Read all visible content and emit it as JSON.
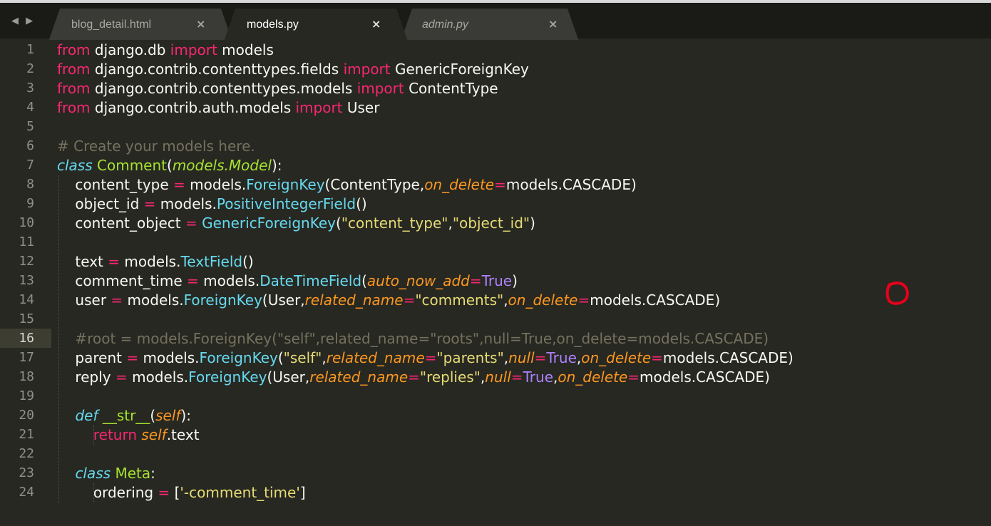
{
  "tabs": [
    {
      "label": "blog_detail.html",
      "close": "×",
      "active": false,
      "italic": false
    },
    {
      "label": "models.py",
      "close": "×",
      "active": true,
      "italic": false
    },
    {
      "label": "admin.py",
      "close": "×",
      "active": false,
      "italic": true
    }
  ],
  "nav_arrows": "◀ ▶",
  "current_line": 16,
  "colors": {
    "background": "#272822",
    "keyword": "#f92672",
    "function": "#66d9ef",
    "class_name": "#a6e22e",
    "parameter": "#fd971f",
    "string": "#e6db74",
    "constant": "#ae81ff",
    "comment": "#75715e",
    "annotation": "#e8001a"
  },
  "annotation_icon": "hand-drawn-red-circle",
  "lines": [
    {
      "n": "1",
      "tokens": [
        [
          "kw",
          "from"
        ],
        [
          "plain",
          " django.db "
        ],
        [
          "kw",
          "import"
        ],
        [
          "plain",
          " models"
        ]
      ]
    },
    {
      "n": "2",
      "tokens": [
        [
          "kw",
          "from"
        ],
        [
          "plain",
          " django.contrib.contenttypes.fields "
        ],
        [
          "kw",
          "import"
        ],
        [
          "plain",
          " GenericForeignKey"
        ]
      ]
    },
    {
      "n": "3",
      "tokens": [
        [
          "kw",
          "from"
        ],
        [
          "plain",
          " django.contrib.contenttypes.models "
        ],
        [
          "kw",
          "import"
        ],
        [
          "plain",
          " ContentType"
        ]
      ]
    },
    {
      "n": "4",
      "tokens": [
        [
          "kw",
          "from"
        ],
        [
          "plain",
          " django.contrib.auth.models "
        ],
        [
          "kw",
          "import"
        ],
        [
          "plain",
          " User"
        ]
      ]
    },
    {
      "n": "5",
      "tokens": []
    },
    {
      "n": "6",
      "tokens": [
        [
          "cmt",
          "# Create your models here."
        ]
      ]
    },
    {
      "n": "7",
      "tokens": [
        [
          "cls",
          "class"
        ],
        [
          "plain",
          " "
        ],
        [
          "ent",
          "Comment"
        ],
        [
          "plain",
          "("
        ],
        [
          "inh",
          "models.Model"
        ],
        [
          "plain",
          "):"
        ]
      ]
    },
    {
      "n": "8",
      "tokens": [
        [
          "plain",
          "    content_type "
        ],
        [
          "op",
          "="
        ],
        [
          "plain",
          " models."
        ],
        [
          "fn",
          "ForeignKey"
        ],
        [
          "plain",
          "(ContentType,"
        ],
        [
          "param",
          "on_delete"
        ],
        [
          "op",
          "="
        ],
        [
          "plain",
          "models.CASCADE)"
        ]
      ]
    },
    {
      "n": "9",
      "tokens": [
        [
          "plain",
          "    object_id "
        ],
        [
          "op",
          "="
        ],
        [
          "plain",
          " models."
        ],
        [
          "fn",
          "PositiveIntegerField"
        ],
        [
          "plain",
          "()"
        ]
      ]
    },
    {
      "n": "10",
      "tokens": [
        [
          "plain",
          "    content_object "
        ],
        [
          "op",
          "="
        ],
        [
          "plain",
          " "
        ],
        [
          "fn",
          "GenericForeignKey"
        ],
        [
          "plain",
          "("
        ],
        [
          "str",
          "\"content_type\""
        ],
        [
          "plain",
          ","
        ],
        [
          "str",
          "\"object_id\""
        ],
        [
          "plain",
          ")"
        ]
      ]
    },
    {
      "n": "11",
      "tokens": []
    },
    {
      "n": "12",
      "tokens": [
        [
          "plain",
          "    text "
        ],
        [
          "op",
          "="
        ],
        [
          "plain",
          " models."
        ],
        [
          "fn",
          "TextField"
        ],
        [
          "plain",
          "()"
        ]
      ]
    },
    {
      "n": "13",
      "tokens": [
        [
          "plain",
          "    comment_time "
        ],
        [
          "op",
          "="
        ],
        [
          "plain",
          " models."
        ],
        [
          "fn",
          "DateTimeField"
        ],
        [
          "plain",
          "("
        ],
        [
          "param",
          "auto_now_add"
        ],
        [
          "op",
          "="
        ],
        [
          "const",
          "True"
        ],
        [
          "plain",
          ")"
        ]
      ]
    },
    {
      "n": "14",
      "tokens": [
        [
          "plain",
          "    user "
        ],
        [
          "op",
          "="
        ],
        [
          "plain",
          " models."
        ],
        [
          "fn",
          "ForeignKey"
        ],
        [
          "plain",
          "(User,"
        ],
        [
          "param",
          "related_name"
        ],
        [
          "op",
          "="
        ],
        [
          "str",
          "\"comments\""
        ],
        [
          "plain",
          ","
        ],
        [
          "param",
          "on_delete"
        ],
        [
          "op",
          "="
        ],
        [
          "plain",
          "models.CASCADE)"
        ]
      ]
    },
    {
      "n": "15",
      "tokens": []
    },
    {
      "n": "16",
      "tokens": [
        [
          "cmt",
          "    #root = models.ForeignKey(\"self\",related_name=\"roots\",null=True,on_delete=models.CASCADE)"
        ]
      ]
    },
    {
      "n": "17",
      "tokens": [
        [
          "plain",
          "    parent "
        ],
        [
          "op",
          "="
        ],
        [
          "plain",
          " models."
        ],
        [
          "fn",
          "ForeignKey"
        ],
        [
          "plain",
          "("
        ],
        [
          "str",
          "\"self\""
        ],
        [
          "plain",
          ","
        ],
        [
          "param",
          "related_name"
        ],
        [
          "op",
          "="
        ],
        [
          "str",
          "\"parents\""
        ],
        [
          "plain",
          ","
        ],
        [
          "param",
          "null"
        ],
        [
          "op",
          "="
        ],
        [
          "const",
          "True"
        ],
        [
          "plain",
          ","
        ],
        [
          "param",
          "on_delete"
        ],
        [
          "op",
          "="
        ],
        [
          "plain",
          "models.CASCADE)"
        ]
      ]
    },
    {
      "n": "18",
      "tokens": [
        [
          "plain",
          "    reply "
        ],
        [
          "op",
          "="
        ],
        [
          "plain",
          " models."
        ],
        [
          "fn",
          "ForeignKey"
        ],
        [
          "plain",
          "(User,"
        ],
        [
          "param",
          "related_name"
        ],
        [
          "op",
          "="
        ],
        [
          "str",
          "\"replies\""
        ],
        [
          "plain",
          ","
        ],
        [
          "param",
          "null"
        ],
        [
          "op",
          "="
        ],
        [
          "const",
          "True"
        ],
        [
          "plain",
          ","
        ],
        [
          "param",
          "on_delete"
        ],
        [
          "op",
          "="
        ],
        [
          "plain",
          "models.CASCADE)"
        ]
      ]
    },
    {
      "n": "19",
      "tokens": []
    },
    {
      "n": "20",
      "tokens": [
        [
          "plain",
          "    "
        ],
        [
          "cls",
          "def"
        ],
        [
          "plain",
          " "
        ],
        [
          "ent",
          "__str__"
        ],
        [
          "plain",
          "("
        ],
        [
          "param",
          "self"
        ],
        [
          "plain",
          "):"
        ]
      ]
    },
    {
      "n": "21",
      "tokens": [
        [
          "plain",
          "        "
        ],
        [
          "kw",
          "return"
        ],
        [
          "plain",
          " "
        ],
        [
          "param",
          "self"
        ],
        [
          "plain",
          ".text"
        ]
      ]
    },
    {
      "n": "22",
      "tokens": []
    },
    {
      "n": "23",
      "tokens": [
        [
          "plain",
          "    "
        ],
        [
          "cls",
          "class"
        ],
        [
          "plain",
          " "
        ],
        [
          "ent",
          "Meta"
        ],
        [
          "plain",
          ":"
        ]
      ]
    },
    {
      "n": "24",
      "tokens": [
        [
          "plain",
          "        ordering "
        ],
        [
          "op",
          "="
        ],
        [
          "plain",
          " ["
        ],
        [
          "str",
          "'-comment_time'"
        ],
        [
          "plain",
          "]"
        ]
      ]
    }
  ]
}
